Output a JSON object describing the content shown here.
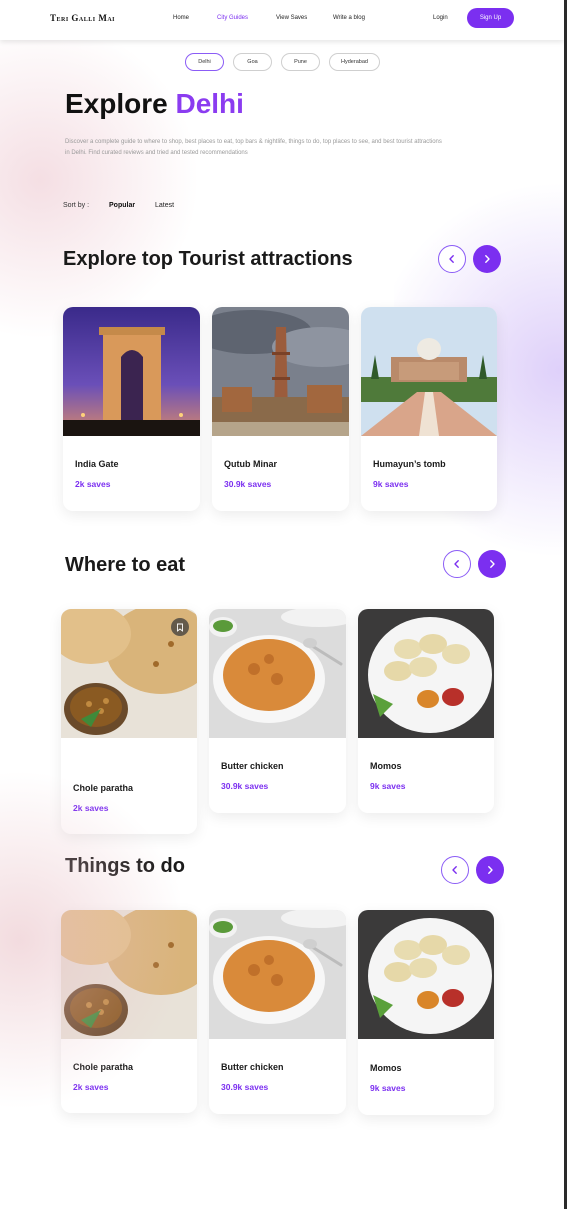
{
  "header": {
    "logo": "Teri Galli Mai",
    "nav": [
      "Home",
      "City Guides",
      "View Saves",
      "Write a blog"
    ],
    "login": "Login",
    "signup": "Sign Up"
  },
  "cities": [
    "Delhi",
    "Goa",
    "Pune",
    "Hyderabad"
  ],
  "hero": {
    "title_prefix": "Explore ",
    "title_city": "Delhi",
    "description": "Discover a complete guide to where to shop, best places to eat, top bars & nightlife, things to do, top places to see, and best tourist attractions in Delhi. Find curated reviews and tried and tested recommendations"
  },
  "sort": {
    "label": "Sort by :",
    "options": [
      "Popular",
      "Latest"
    ]
  },
  "sections": [
    {
      "title": "Explore top Tourist attractions",
      "cards": [
        {
          "name": "India Gate",
          "saves": "2k saves",
          "image": "india-gate-photo"
        },
        {
          "name": "Qutub Minar",
          "saves": "30.9k saves",
          "image": "qutub-minar-photo"
        },
        {
          "name": "Humayun’s tomb",
          "saves": "9k saves",
          "image": "humayuns-tomb-photo"
        }
      ]
    },
    {
      "title": "Where to eat",
      "cards": [
        {
          "name": "Chole paratha",
          "saves": "2k saves",
          "image": "chole-paratha-photo"
        },
        {
          "name": "Butter chicken",
          "saves": "30.9k saves",
          "image": "butter-chicken-photo"
        },
        {
          "name": "Momos",
          "saves": "9k saves",
          "image": "momos-photo"
        }
      ]
    },
    {
      "title": "Things to do",
      "cards": [
        {
          "name": "Chole paratha",
          "saves": "2k saves",
          "image": "chole-paratha-photo"
        },
        {
          "name": "Butter chicken",
          "saves": "30.9k saves",
          "image": "butter-chicken-photo"
        },
        {
          "name": "Momos",
          "saves": "9k saves",
          "image": "momos-photo"
        }
      ]
    }
  ],
  "colors": {
    "accent": "#7b2ff0",
    "title_city": "#8b3cf0",
    "text": "#1a1a1a",
    "muted": "#9a9a9a"
  }
}
